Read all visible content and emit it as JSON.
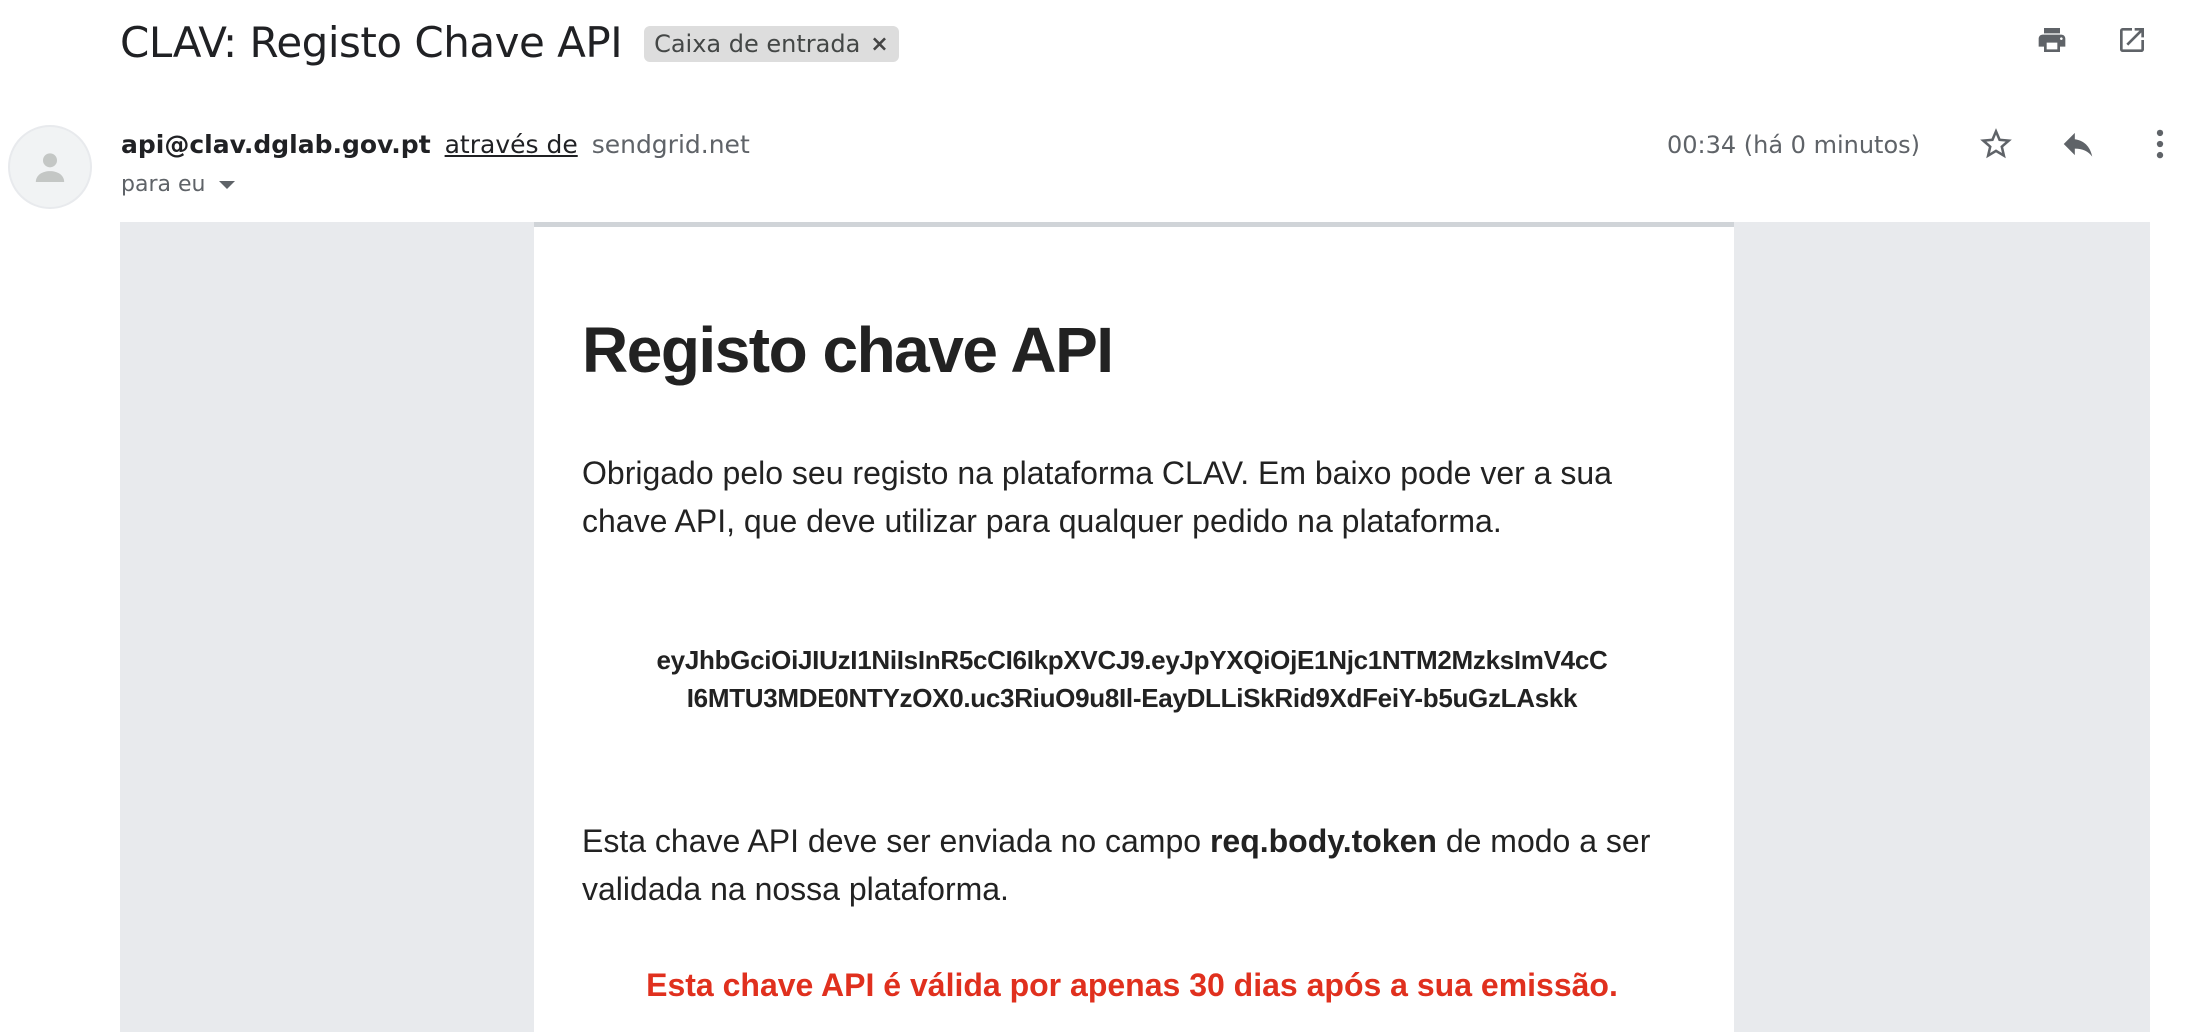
{
  "header": {
    "subject": "CLAV: Registo Chave API",
    "label": "Caixa de entrada",
    "label_remove": "×",
    "icons": [
      "print-icon",
      "open-in-new-window-icon"
    ]
  },
  "message": {
    "sender_email": "api@clav.dglab.gov.pt",
    "via_text": "através de",
    "via_domain": "sendgrid.net",
    "to_text": "para eu",
    "time": "00:34 (há 0 minutos)",
    "icons": [
      "star-icon",
      "reply-icon",
      "more-vert-icon"
    ]
  },
  "body": {
    "title": "Registo chave API",
    "intro": "Obrigado pelo seu registo na plataforma CLAV. Em baixo pode ver a sua chave API, que deve utilizar para qualquer pedido na plataforma.",
    "token_line1": "eyJhbGciOiJIUzI1NiIsInR5cCI6IkpXVCJ9.eyJpYXQiOjE1Njc1NTM2MzksImV4cC",
    "token_line2": "I6MTU3MDE0NTYzOX0.uc3RiuO9u8Il-EayDLLiSkRid9XdFeiY-b5uGzLAskk",
    "field_text_before": "Esta chave API deve ser enviada no campo ",
    "field_name": "req.body.token",
    "field_text_after": " de modo a ser validada na nossa plataforma.",
    "validity_warning": "Esta chave API é válida por apenas 30 dias após a sua emissão."
  },
  "colors": {
    "warning": "#e0301e",
    "body_background": "#e8eaed",
    "chip_background": "#dddddd"
  }
}
